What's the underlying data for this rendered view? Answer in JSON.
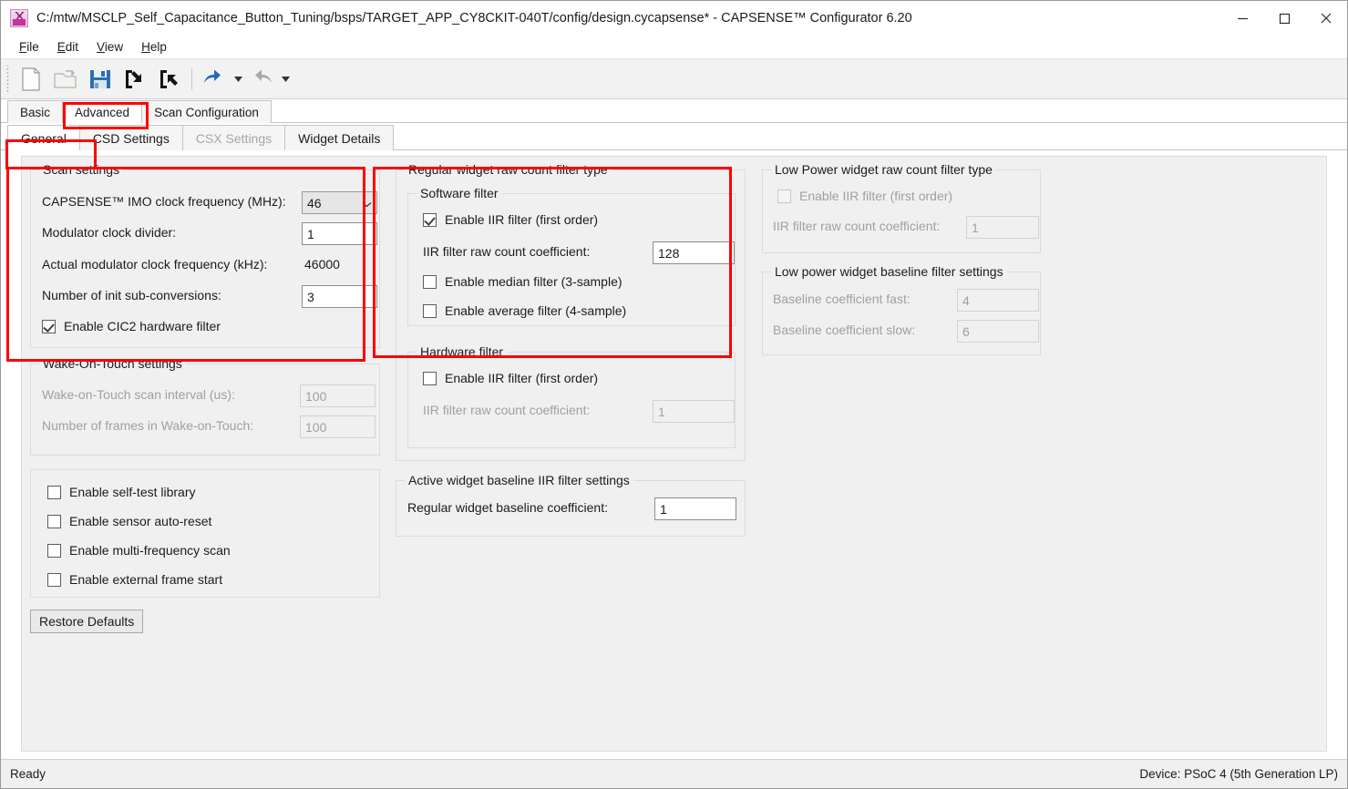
{
  "window": {
    "title": "C:/mtw/MSCLP_Self_Capacitance_Button_Tuning/bsps/TARGET_APP_CY8CKIT-040T/config/design.cycapsense* - CAPSENSE™ Configurator 6.20",
    "minimize_label": "Minimize",
    "maximize_label": "Maximize",
    "close_label": "Close"
  },
  "menubar": [
    {
      "label": "File",
      "mnemonic": "F"
    },
    {
      "label": "Edit",
      "mnemonic": "E"
    },
    {
      "label": "View",
      "mnemonic": "V"
    },
    {
      "label": "Help",
      "mnemonic": "H"
    }
  ],
  "toolbar": [
    {
      "name": "new-file-icon",
      "title": "New"
    },
    {
      "name": "open-file-icon",
      "title": "Open"
    },
    {
      "name": "save-icon",
      "title": "Save"
    },
    {
      "name": "import-icon",
      "title": "Import"
    },
    {
      "name": "export-icon",
      "title": "Export"
    },
    {
      "name": "undo-icon",
      "title": "Undo"
    },
    {
      "name": "redo-icon",
      "title": "Redo"
    }
  ],
  "outer_tabs": [
    {
      "label": "Basic",
      "active": false
    },
    {
      "label": "Advanced",
      "active": true
    },
    {
      "label": "Scan Configuration",
      "active": false
    }
  ],
  "inner_tabs": [
    {
      "label": "General",
      "active": true,
      "disabled": false
    },
    {
      "label": "CSD Settings",
      "active": false,
      "disabled": false
    },
    {
      "label": "CSX Settings",
      "active": false,
      "disabled": true
    },
    {
      "label": "Widget Details",
      "active": false,
      "disabled": false
    }
  ],
  "scan_settings": {
    "title": "Scan settings",
    "imo_label": "CAPSENSE™ IMO clock frequency (MHz):",
    "imo_value": "46",
    "mod_divider_label": "Modulator clock divider:",
    "mod_divider_value": "1",
    "actual_mod_label": "Actual modulator clock frequency (kHz):",
    "actual_mod_value": "46000",
    "init_subconv_label": "Number of init sub-conversions:",
    "init_subconv_value": "3",
    "cic2_label": "Enable CIC2 hardware filter",
    "cic2_checked": true
  },
  "wake_on_touch": {
    "title": "Wake-On-Touch settings",
    "interval_label": "Wake-on-Touch scan interval (us):",
    "interval_value": "100",
    "frames_label": "Number of frames in Wake-on-Touch:",
    "frames_value": "100"
  },
  "feature_checkboxes": [
    {
      "label": "Enable self-test library",
      "checked": false
    },
    {
      "label": "Enable sensor auto-reset",
      "checked": false
    },
    {
      "label": "Enable multi-frequency scan",
      "checked": false
    },
    {
      "label": "Enable external frame start",
      "checked": false
    }
  ],
  "restore_defaults_label": "Restore Defaults",
  "regular_widget_filter": {
    "title": "Regular widget raw count filter type",
    "software_filter": {
      "title": "Software filter",
      "iir_label": "Enable IIR filter (first order)",
      "iir_checked": true,
      "iir_coeff_label": "IIR filter raw count coefficient:",
      "iir_coeff_value": "128",
      "median_label": "Enable median filter (3-sample)",
      "median_checked": false,
      "average_label": "Enable average filter (4-sample)",
      "average_checked": false
    },
    "hardware_filter": {
      "title": "Hardware filter",
      "iir_label": "Enable IIR filter (first order)",
      "iir_checked": false,
      "iir_coeff_label": "IIR filter raw count coefficient:",
      "iir_coeff_value": "1"
    }
  },
  "active_widget_baseline": {
    "title": "Active widget baseline IIR filter settings",
    "coeff_label": "Regular widget baseline coefficient:",
    "coeff_value": "1"
  },
  "low_power_filter": {
    "title": "Low Power widget raw count filter type",
    "iir_label": "Enable IIR filter (first order)",
    "iir_checked": false,
    "iir_coeff_label": "IIR filter raw count coefficient:",
    "iir_coeff_value": "1"
  },
  "low_power_baseline": {
    "title": "Low power widget baseline filter settings",
    "fast_label": "Baseline coefficient fast:",
    "fast_value": "4",
    "slow_label": "Baseline coefficient slow:",
    "slow_value": "6"
  },
  "statusbar": {
    "left": "Ready",
    "right": "Device: PSoC 4 (5th Generation LP)"
  },
  "colors": {
    "annotation": "#ff0000",
    "panel_bg": "#f0f0f0",
    "window_bg": "#ffffff",
    "text": "#1b1b1b",
    "disabled_text": "#a0a0a0"
  }
}
